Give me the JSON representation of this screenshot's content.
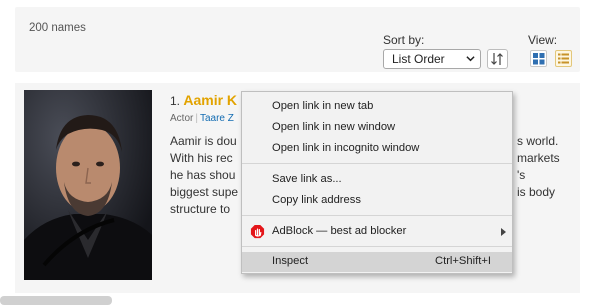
{
  "header": {
    "count": "200 names",
    "sort_label": "Sort by:",
    "sort_value": "List Order",
    "view_label": "View:"
  },
  "item": {
    "number": "1.",
    "name": "Aamir K",
    "role": "Actor",
    "known_for": "Taare Z",
    "bio_lines": [
      "Aamir is dou",
      "With his rec",
      "he has shou",
      "biggest supe",
      "structure to"
    ],
    "bio_right": [
      "s world.",
      "markets",
      "'s",
      "is body"
    ]
  },
  "context_menu": {
    "items": [
      {
        "label": "Open link in new tab"
      },
      {
        "label": "Open link in new window"
      },
      {
        "label": "Open link in incognito window"
      },
      {
        "label": "Save link as..."
      },
      {
        "label": "Copy link address"
      },
      {
        "label": "AdBlock — best ad blocker"
      },
      {
        "label": "Inspect",
        "shortcut": "Ctrl+Shift+I"
      }
    ]
  },
  "colors": {
    "name_accent": "#e2a300",
    "link": "#136cb2",
    "menu_bg": "#f2f2f2",
    "menu_highlight": "#d4d4d4",
    "adblock_red": "#e4161a"
  },
  "icons": [
    "chevron-down-icon",
    "sort-direction-icon",
    "grid-view-icon",
    "list-view-icon",
    "adblock-hand-icon",
    "submenu-arrow-icon"
  ]
}
